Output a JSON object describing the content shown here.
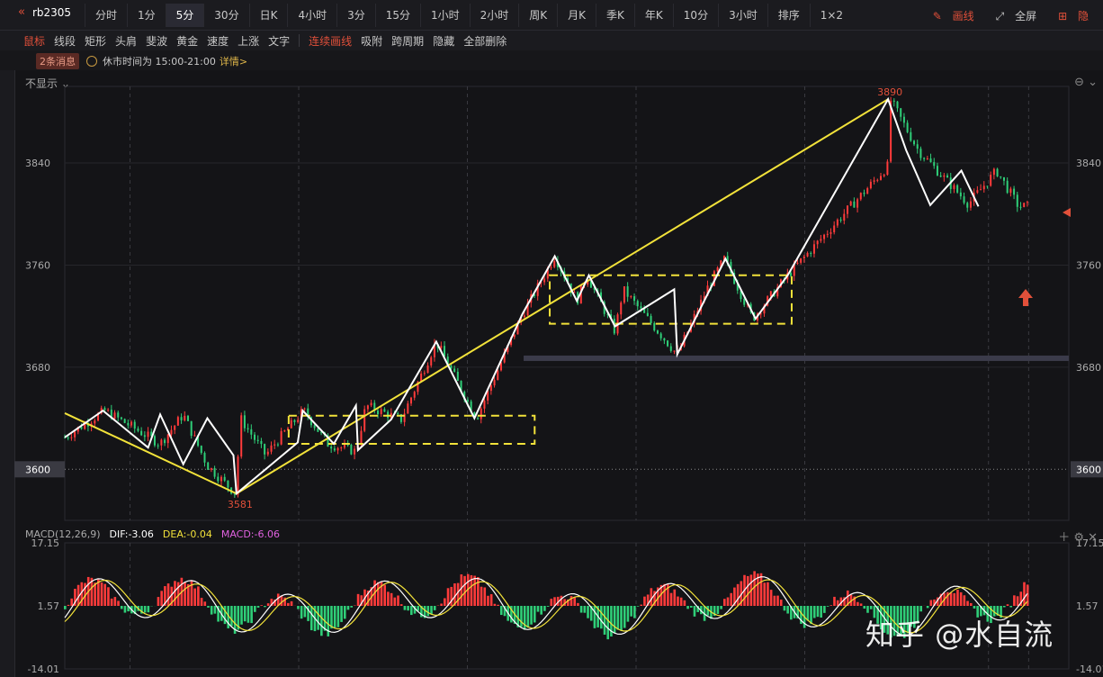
{
  "toolbar": {
    "symbol": "rb2305",
    "timeframes": [
      "分时",
      "1分",
      "5分",
      "30分",
      "日K",
      "4小时",
      "3分",
      "15分",
      "1小时",
      "2小时",
      "周K",
      "月K",
      "季K",
      "年K",
      "10分",
      "3小时",
      "排序",
      "1×2"
    ],
    "active_timeframe": "5分",
    "draw_label": "画线",
    "fullscreen_label": "全屏",
    "extra_label": "隐"
  },
  "drawing_tools": [
    "鼠标",
    "线段",
    "矩形",
    "头肩",
    "斐波",
    "黄金",
    "速度",
    "上涨",
    "文字",
    "连续画线",
    "吸附",
    "跨周期",
    "隐藏",
    "全部删除"
  ],
  "message_bar": {
    "badge": "2条消息",
    "text": "休市时间为 15:00-21:00",
    "detail": "详情>"
  },
  "hide_label": "不显示",
  "colors": {
    "up": "#ff3b3b",
    "down": "#2fcf78",
    "white_line": "#ffffff",
    "yellow_line": "#f2e23a",
    "dif": "#ffffff",
    "dea": "#f2e23a",
    "macd_label": "#e062e0"
  },
  "macd_header": {
    "name": "MACD(12,26,9)",
    "dif": "DIF:-3.06",
    "dea": "DEA:-0.04",
    "macd": "MACD:-6.06"
  },
  "watermark": "知乎 @水自流",
  "chart_data": [
    {
      "type": "candlestick",
      "ylim": [
        3560,
        3900
      ],
      "y_ticks": [
        3600,
        3680,
        3760,
        3840
      ],
      "current_price_label": "3600",
      "annotations": {
        "low_label": "3581",
        "high_label": "3890"
      },
      "white_zigzag": [
        3625,
        3646,
        3620,
        3643,
        3603,
        3640,
        3611,
        3581,
        3621,
        3646,
        3620,
        3650,
        3614,
        3639,
        3700,
        3640,
        3722,
        3741,
        3767,
        3732,
        3752,
        3708,
        3741,
        3690,
        3742,
        3765,
        3718,
        3752,
        3838,
        3890,
        3850,
        3808,
        3834,
        3806
      ],
      "yellow_trendlines": [
        {
          "from": 3644,
          "to": 3581
        },
        {
          "from": 3581,
          "to": 3890
        }
      ],
      "rectangles": [
        {
          "top": 3642,
          "bottom": 3620
        },
        {
          "top": 3752,
          "bottom": 3714
        }
      ],
      "support_band": 3687
    },
    {
      "type": "bar",
      "name": "MACD",
      "ylim": [
        -14.01,
        17.15
      ],
      "y_ticks": [
        17.15,
        1.57,
        -14.01
      ]
    }
  ]
}
